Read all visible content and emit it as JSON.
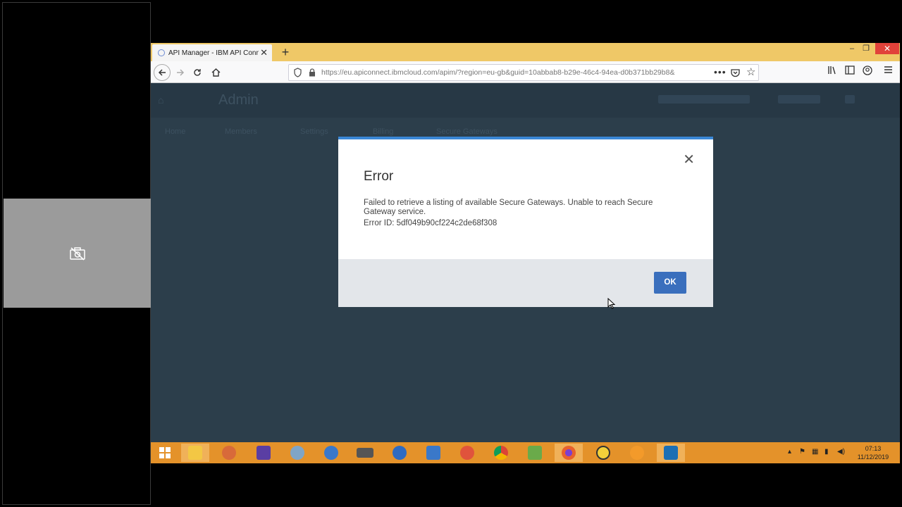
{
  "browser": {
    "tab_title": "API Manager - IBM API Connect",
    "tab_close": "✕",
    "new_tab": "+",
    "window_controls": {
      "minimize": "–",
      "maximize": "❐",
      "close": "✕"
    },
    "url": "https://eu.apiconnect.ibmcloud.com/apim/?region=eu-gb&guid=10abbab8-b29e-46c4-94ea-d0b371bb29b8&",
    "url_more": "•••"
  },
  "page": {
    "title": "Admin",
    "tabs": [
      "Home",
      "Members",
      "Settings",
      "Billing",
      "Secure Gateways"
    ]
  },
  "modal": {
    "title": "Error",
    "close_label": "✕",
    "message": "Failed to retrieve a listing of available Secure Gateways. Unable to reach Secure Gateway service.",
    "error_id": "Error ID: 5df049b90cf224c2de68f308",
    "ok_label": "OK"
  },
  "taskbar": {
    "time": "07:13",
    "date": "11/12/2019",
    "apps": [
      {
        "name": "start",
        "color": "#ffffff"
      },
      {
        "name": "file-explorer",
        "color": "#f3c744"
      },
      {
        "name": "paint",
        "color": "#d86a3a"
      },
      {
        "name": "settings",
        "color": "#5a3ea3"
      },
      {
        "name": "paint-3d",
        "color": "#7fa5c7"
      },
      {
        "name": "globe",
        "color": "#3a78c9"
      },
      {
        "name": "media",
        "color": "#555555"
      },
      {
        "name": "network-globe",
        "color": "#2f6bc1"
      },
      {
        "name": "window-app",
        "color": "#3a78c9"
      },
      {
        "name": "git",
        "color": "#e0533c"
      },
      {
        "name": "chrome",
        "color": "#4a9e4f"
      },
      {
        "name": "notepad-plus",
        "color": "#6aaa4a"
      },
      {
        "name": "firefox",
        "color": "#e8612c"
      },
      {
        "name": "app-circle",
        "color": "#f3d03a"
      },
      {
        "name": "snowflake-app",
        "color": "#f39a2a"
      },
      {
        "name": "photos",
        "color": "#1c6fb4"
      }
    ]
  },
  "colors": {
    "modal_accent": "#3a87d6",
    "ok_button": "#3a6fbd",
    "taskbar": "#e4922a",
    "tab_strip": "#efc867"
  }
}
